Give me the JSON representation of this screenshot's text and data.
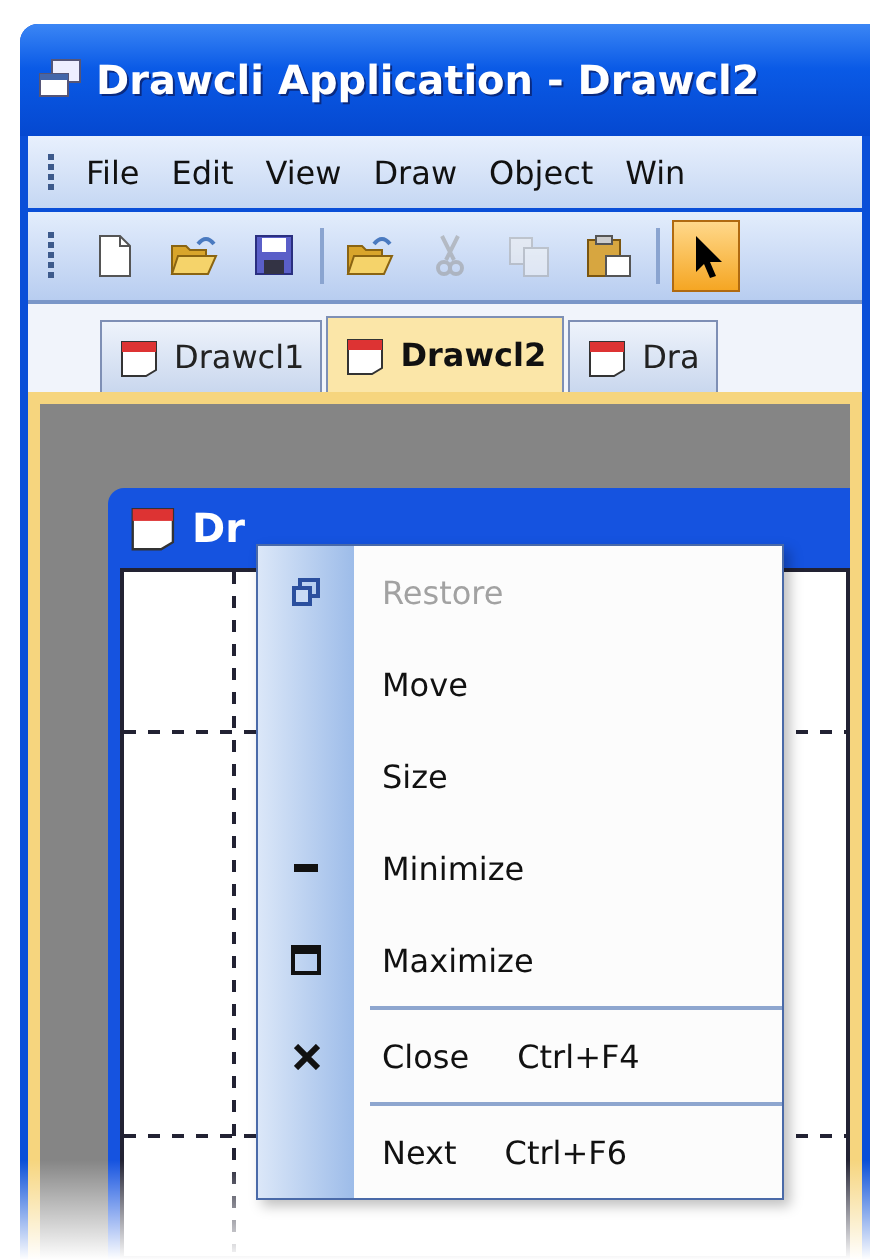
{
  "window": {
    "title": "Drawcli Application - Drawcl2"
  },
  "menu_bar": [
    {
      "label": "File"
    },
    {
      "label": "Edit"
    },
    {
      "label": "View"
    },
    {
      "label": "Draw"
    },
    {
      "label": "Object"
    },
    {
      "label": "Win"
    }
  ],
  "toolbar": {
    "buttons": [
      {
        "disabled": false,
        "pressed": false
      },
      {
        "disabled": false,
        "pressed": false
      },
      {
        "disabled": false,
        "pressed": false
      },
      {
        "disabled": false,
        "pressed": false
      },
      {
        "disabled": true,
        "pressed": false
      },
      {
        "disabled": true,
        "pressed": false
      },
      {
        "disabled": false,
        "pressed": false
      },
      {
        "disabled": false,
        "pressed": true
      }
    ]
  },
  "tabs": [
    {
      "label": "Drawcl1",
      "selected": false
    },
    {
      "label": "Drawcl2",
      "selected": true
    },
    {
      "label": "Dra",
      "selected": false
    }
  ],
  "child_window": {
    "title": "Dr"
  },
  "context_menu": [
    {
      "label": "Restore",
      "disabled": true,
      "separator_before": false
    },
    {
      "label": "Move",
      "disabled": false,
      "separator_before": false
    },
    {
      "label": "Size",
      "disabled": false,
      "separator_before": false
    },
    {
      "label": "Minimize",
      "disabled": false,
      "separator_before": false
    },
    {
      "label": "Maximize",
      "disabled": false,
      "separator_before": false
    },
    {
      "label": "Close",
      "shortcut": "Ctrl+F4",
      "disabled": false,
      "separator_before": true
    },
    {
      "label": "Next",
      "shortcut": "Ctrl+F6",
      "disabled": false,
      "separator_before": true
    }
  ]
}
